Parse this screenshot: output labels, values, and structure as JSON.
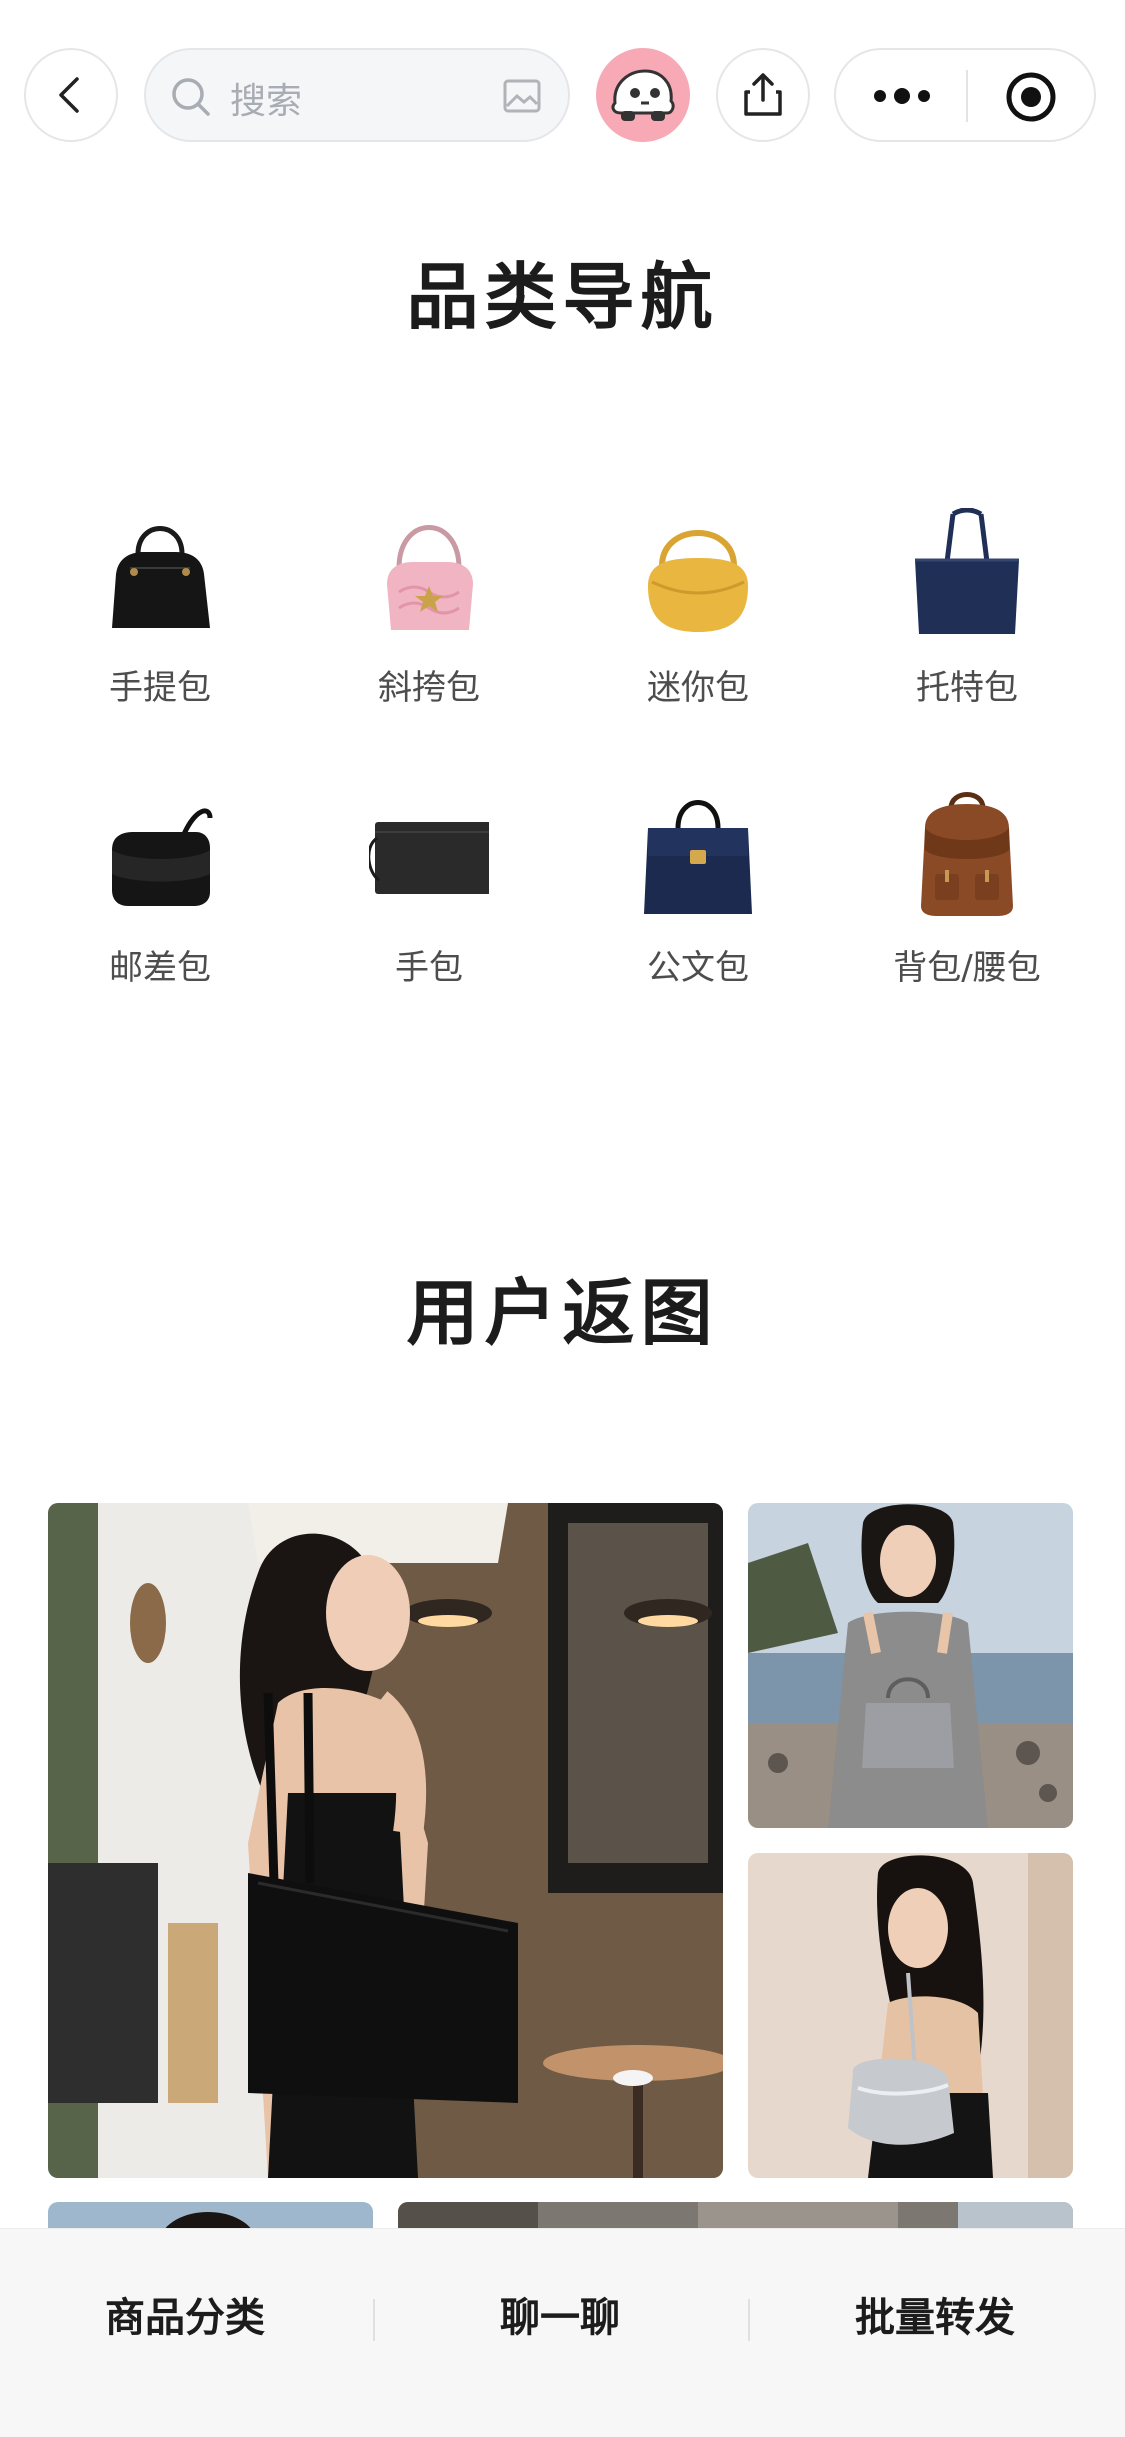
{
  "header": {
    "search": {
      "placeholder": "搜索"
    },
    "icons": [
      "back-icon",
      "search-icon",
      "image-search-icon",
      "avatar-icon",
      "share-icon",
      "more-icon",
      "target-icon"
    ]
  },
  "categories": {
    "title": "品类导航",
    "items": [
      {
        "label": "手提包",
        "icon": "handbag-icon"
      },
      {
        "label": "斜挎包",
        "icon": "crossbody-bag-icon"
      },
      {
        "label": "迷你包",
        "icon": "mini-bag-icon"
      },
      {
        "label": "托特包",
        "icon": "tote-bag-icon"
      },
      {
        "label": "邮差包",
        "icon": "messenger-bag-icon"
      },
      {
        "label": "手包",
        "icon": "clutch-icon"
      },
      {
        "label": "公文包",
        "icon": "briefcase-icon"
      },
      {
        "label": "背包/腰包",
        "icon": "backpack-icon"
      }
    ]
  },
  "gallery": {
    "title": "用户返图"
  },
  "bottom_bar": {
    "items": [
      "商品分类",
      "聊一聊",
      "批量转发"
    ]
  },
  "colors": {
    "avatar_bg": "#f7a9b5",
    "tote_navy": "#1f2f55",
    "mini_yellow": "#e9b640",
    "crossbody_pink": "#f0b4c2",
    "backpack_brown": "#8a4a25"
  }
}
